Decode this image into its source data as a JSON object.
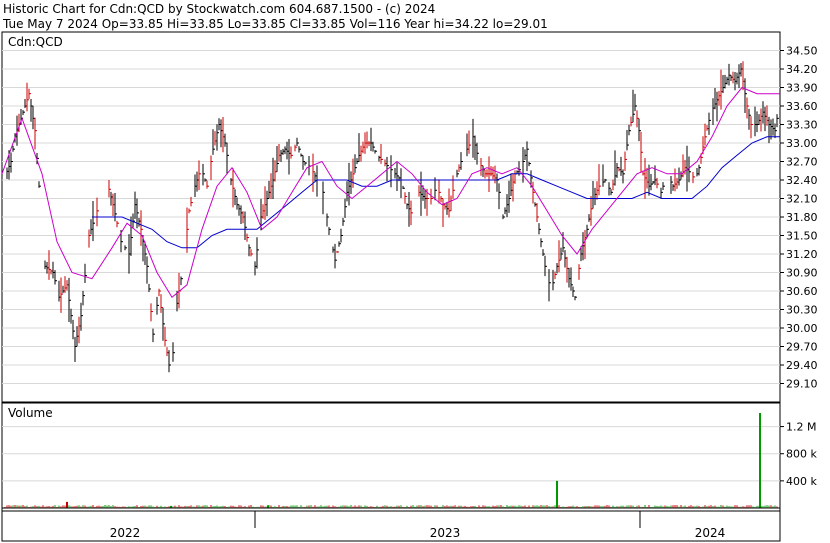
{
  "header": {
    "line1": "Historic Chart for Cdn:QCD by Stockwatch.com 604.687.1500 - (c) 2024",
    "line2": "Tue May  7 2024  Op=33.85  Hi=33.85  Lo=33.85  Cl=33.85  Vol=116  Year hi=34.22  lo=29.01"
  },
  "chart_data": [
    {
      "type": "ohlc",
      "title": "Cdn:QCD",
      "ylim": [
        28.8,
        34.8
      ],
      "yticks": [
        34.5,
        34.2,
        33.9,
        33.6,
        33.3,
        33.0,
        32.7,
        32.4,
        32.1,
        31.8,
        31.5,
        31.2,
        30.9,
        30.6,
        30.3,
        30.0,
        29.7,
        29.4,
        29.1
      ],
      "ytick_labels": [
        "34.50",
        "34.20",
        "33.90",
        "33.60",
        "33.30",
        "33.00",
        "32.70",
        "32.40",
        "32.10",
        "31.80",
        "31.50",
        "31.20",
        "30.90",
        "30.60",
        "30.30",
        "30.00",
        "29.70",
        "29.40",
        "29.10"
      ],
      "x_labels": [
        "2022",
        "2023",
        "2024"
      ],
      "price_path": [
        [
          0,
          32.3
        ],
        [
          10,
          32.7
        ],
        [
          14,
          33.1
        ],
        [
          20,
          33.4
        ],
        [
          28,
          33.8
        ],
        [
          34,
          33.2
        ],
        [
          38,
          32.3
        ],
        [
          44,
          31.0
        ],
        [
          52,
          30.9
        ],
        [
          58,
          30.5
        ],
        [
          66,
          30.7
        ],
        [
          74,
          29.7
        ],
        [
          80,
          30.2
        ],
        [
          88,
          31.5
        ],
        [
          96,
          31.9
        ],
        [
          104,
          32.5
        ],
        [
          112,
          32.0
        ],
        [
          120,
          31.4
        ],
        [
          128,
          31.2
        ],
        [
          134,
          32.0
        ],
        [
          140,
          31.6
        ],
        [
          146,
          31.0
        ],
        [
          152,
          29.9
        ],
        [
          158,
          30.6
        ],
        [
          164,
          29.8
        ],
        [
          170,
          29.2
        ],
        [
          176,
          30.4
        ],
        [
          182,
          31.0
        ],
        [
          188,
          31.9
        ],
        [
          194,
          32.3
        ],
        [
          200,
          32.6
        ],
        [
          206,
          32.3
        ],
        [
          212,
          32.9
        ],
        [
          218,
          33.3
        ],
        [
          224,
          33.0
        ],
        [
          230,
          32.4
        ],
        [
          236,
          32.0
        ],
        [
          242,
          31.8
        ],
        [
          248,
          31.3
        ],
        [
          254,
          31.0
        ],
        [
          260,
          31.8
        ],
        [
          266,
          32.1
        ],
        [
          272,
          32.4
        ],
        [
          278,
          32.8
        ],
        [
          284,
          32.9
        ],
        [
          290,
          32.8
        ],
        [
          296,
          33.0
        ],
        [
          302,
          32.7
        ],
        [
          310,
          32.6
        ],
        [
          316,
          32.4
        ],
        [
          322,
          32.2
        ],
        [
          328,
          31.6
        ],
        [
          334,
          31.1
        ],
        [
          340,
          31.5
        ],
        [
          346,
          32.2
        ],
        [
          352,
          32.5
        ],
        [
          358,
          32.8
        ],
        [
          364,
          33.0
        ],
        [
          370,
          33.0
        ],
        [
          376,
          32.8
        ],
        [
          382,
          32.7
        ],
        [
          388,
          32.6
        ],
        [
          394,
          32.5
        ],
        [
          400,
          32.4
        ],
        [
          406,
          32.0
        ],
        [
          412,
          31.8
        ],
        [
          418,
          32.2
        ],
        [
          424,
          32.1
        ],
        [
          430,
          32.1
        ],
        [
          436,
          32.3
        ],
        [
          442,
          32.0
        ],
        [
          448,
          31.9
        ],
        [
          454,
          32.4
        ],
        [
          460,
          32.7
        ],
        [
          466,
          32.9
        ],
        [
          472,
          33.1
        ],
        [
          478,
          32.7
        ],
        [
          484,
          32.5
        ],
        [
          490,
          32.5
        ],
        [
          496,
          32.4
        ],
        [
          502,
          31.8
        ],
        [
          508,
          32.1
        ],
        [
          514,
          32.5
        ],
        [
          520,
          32.6
        ],
        [
          526,
          32.9
        ],
        [
          532,
          32.2
        ],
        [
          538,
          31.6
        ],
        [
          544,
          31.0
        ],
        [
          550,
          30.6
        ],
        [
          556,
          31.0
        ],
        [
          562,
          31.3
        ],
        [
          568,
          30.8
        ],
        [
          574,
          30.5
        ],
        [
          580,
          31.2
        ],
        [
          586,
          31.6
        ],
        [
          592,
          32.1
        ],
        [
          598,
          32.3
        ],
        [
          604,
          32.4
        ],
        [
          610,
          32.2
        ],
        [
          616,
          32.6
        ],
        [
          622,
          32.5
        ],
        [
          628,
          33.2
        ],
        [
          634,
          33.6
        ],
        [
          638,
          33.2
        ],
        [
          642,
          32.5
        ],
        [
          648,
          32.3
        ],
        [
          654,
          32.4
        ],
        [
          660,
          32.2
        ],
        [
          666,
          32.5
        ],
        [
          672,
          32.3
        ],
        [
          678,
          32.4
        ],
        [
          684,
          32.6
        ],
        [
          690,
          32.5
        ],
        [
          694,
          32.4
        ],
        [
          698,
          32.6
        ],
        [
          704,
          33.1
        ],
        [
          710,
          33.5
        ],
        [
          716,
          33.7
        ],
        [
          722,
          33.9
        ],
        [
          728,
          34.1
        ],
        [
          734,
          34.0
        ],
        [
          740,
          34.2
        ],
        [
          746,
          33.6
        ],
        [
          750,
          33.3
        ],
        [
          756,
          33.3
        ],
        [
          762,
          33.5
        ],
        [
          768,
          33.3
        ],
        [
          774,
          33.2
        ],
        [
          778,
          33.6
        ]
      ],
      "ma_short_path": [
        [
          0,
          32.5
        ],
        [
          20,
          33.4
        ],
        [
          40,
          32.5
        ],
        [
          55,
          31.4
        ],
        [
          70,
          30.9
        ],
        [
          90,
          30.8
        ],
        [
          110,
          31.3
        ],
        [
          125,
          31.7
        ],
        [
          140,
          31.5
        ],
        [
          155,
          30.9
        ],
        [
          170,
          30.5
        ],
        [
          185,
          30.7
        ],
        [
          200,
          31.6
        ],
        [
          215,
          32.3
        ],
        [
          230,
          32.6
        ],
        [
          245,
          32.2
        ],
        [
          260,
          31.6
        ],
        [
          275,
          31.8
        ],
        [
          290,
          32.2
        ],
        [
          305,
          32.6
        ],
        [
          320,
          32.7
        ],
        [
          335,
          32.3
        ],
        [
          350,
          32.1
        ],
        [
          365,
          32.3
        ],
        [
          380,
          32.5
        ],
        [
          395,
          32.7
        ],
        [
          410,
          32.5
        ],
        [
          425,
          32.2
        ],
        [
          440,
          32.0
        ],
        [
          455,
          32.1
        ],
        [
          470,
          32.5
        ],
        [
          485,
          32.6
        ],
        [
          500,
          32.5
        ],
        [
          515,
          32.6
        ],
        [
          530,
          32.3
        ],
        [
          545,
          31.9
        ],
        [
          560,
          31.5
        ],
        [
          575,
          31.2
        ],
        [
          590,
          31.6
        ],
        [
          605,
          31.9
        ],
        [
          620,
          32.2
        ],
        [
          635,
          32.5
        ],
        [
          650,
          32.6
        ],
        [
          665,
          32.5
        ],
        [
          680,
          32.5
        ],
        [
          695,
          32.7
        ],
        [
          710,
          33.1
        ],
        [
          725,
          33.6
        ],
        [
          740,
          33.9
        ],
        [
          755,
          33.8
        ],
        [
          778,
          33.8
        ]
      ],
      "ma_long_path": [
        [
          90,
          31.8
        ],
        [
          105,
          31.8
        ],
        [
          120,
          31.8
        ],
        [
          135,
          31.7
        ],
        [
          150,
          31.6
        ],
        [
          165,
          31.4
        ],
        [
          180,
          31.3
        ],
        [
          195,
          31.3
        ],
        [
          210,
          31.5
        ],
        [
          225,
          31.6
        ],
        [
          240,
          31.6
        ],
        [
          255,
          31.6
        ],
        [
          270,
          31.8
        ],
        [
          285,
          32.0
        ],
        [
          300,
          32.2
        ],
        [
          315,
          32.4
        ],
        [
          330,
          32.4
        ],
        [
          345,
          32.4
        ],
        [
          360,
          32.3
        ],
        [
          375,
          32.3
        ],
        [
          390,
          32.4
        ],
        [
          405,
          32.4
        ],
        [
          420,
          32.4
        ],
        [
          435,
          32.4
        ],
        [
          450,
          32.4
        ],
        [
          465,
          32.4
        ],
        [
          480,
          32.4
        ],
        [
          495,
          32.4
        ],
        [
          510,
          32.5
        ],
        [
          525,
          32.5
        ],
        [
          540,
          32.4
        ],
        [
          555,
          32.3
        ],
        [
          570,
          32.2
        ],
        [
          585,
          32.1
        ],
        [
          600,
          32.1
        ],
        [
          615,
          32.1
        ],
        [
          630,
          32.1
        ],
        [
          645,
          32.2
        ],
        [
          660,
          32.1
        ],
        [
          675,
          32.1
        ],
        [
          690,
          32.1
        ],
        [
          705,
          32.3
        ],
        [
          720,
          32.6
        ],
        [
          735,
          32.8
        ],
        [
          750,
          33.0
        ],
        [
          765,
          33.1
        ],
        [
          778,
          33.1
        ]
      ]
    },
    {
      "type": "bar",
      "title": "Volume",
      "ylim": [
        0,
        1400000
      ],
      "yticks": [
        1200000,
        800000,
        400000
      ],
      "ytick_labels": [
        "1.2 M",
        "800 k",
        "400 k"
      ],
      "spikes": [
        {
          "x": 67,
          "value": 90000,
          "color": "#cc0000"
        },
        {
          "x": 171,
          "value": 30000,
          "color": "#009900"
        },
        {
          "x": 268,
          "value": 40000,
          "color": "#009900"
        },
        {
          "x": 557,
          "value": 400000,
          "color": "#009900"
        },
        {
          "x": 760,
          "value": 1400000,
          "color": "#009900"
        }
      ]
    }
  ],
  "colors": {
    "bars": "#000000",
    "up_tick": "#cc0000",
    "ma_short": "#cc00cc",
    "ma_long": "#0000cc",
    "volume": "#009900",
    "grid": "#d8d8d8",
    "divider": "#000000"
  }
}
